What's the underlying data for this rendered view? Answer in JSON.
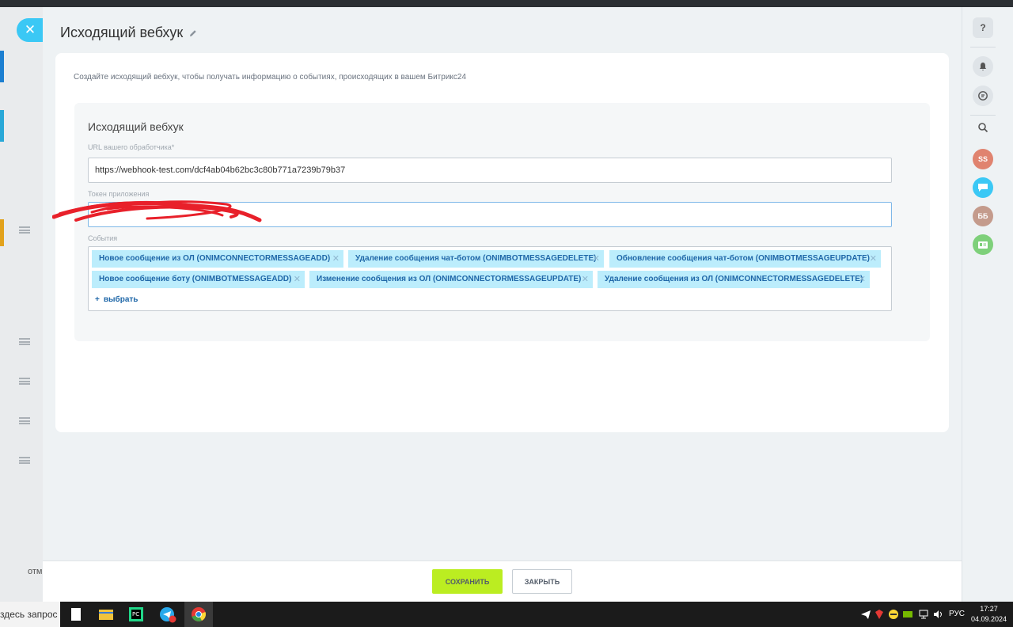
{
  "slider": {
    "title": "Исходящий вебхук",
    "description": "Создайте исходящий вебхук, чтобы получать информацию о событиях, происходящих в вашем Битрикс24",
    "section_title": "Исходящий вебхук",
    "url_label": "URL вашего обработчика*",
    "url_value": "https://webhook-test.com/dcf4ab04b62bc3c80b771a7239b79b37",
    "token_label": "Токен приложения",
    "token_value": "",
    "events_label": "События",
    "events": [
      "Новое сообщение из ОЛ (ONIMCONNECTORMESSAGEADD)",
      "Удаление сообщения чат-ботом (ONIMBOTMESSAGEDELETE)",
      "Обновление сообщения чат-ботом (ONIMBOTMESSAGEUPDATE)",
      "Новое сообщение боту (ONIMBOTMESSAGEADD)",
      "Изменение сообщения из ОЛ (ONIMCONNECTORMESSAGEUPDATE)",
      "Удаление сообщения из ОЛ (ONIMCONNECTORMESSAGEDELETE)"
    ],
    "add_label": "выбрать",
    "save_label": "СОХРАНИТЬ",
    "close_label": "ЗАКРЫТЬ"
  },
  "background": {
    "bottom_text": "отм"
  },
  "right_panel": {
    "help": "?",
    "avatar1": "SS",
    "avatar2": "ББ"
  },
  "taskbar": {
    "search_text": "здесь запрос",
    "telegram_badge": "33",
    "lang": "РУС",
    "time": "17:27",
    "date": "04.09.2024"
  },
  "colors": {
    "accent": "#3bc8f5",
    "save": "#bbed21",
    "tag_bg": "#bcedfc",
    "tag_text": "#1f67a8"
  }
}
